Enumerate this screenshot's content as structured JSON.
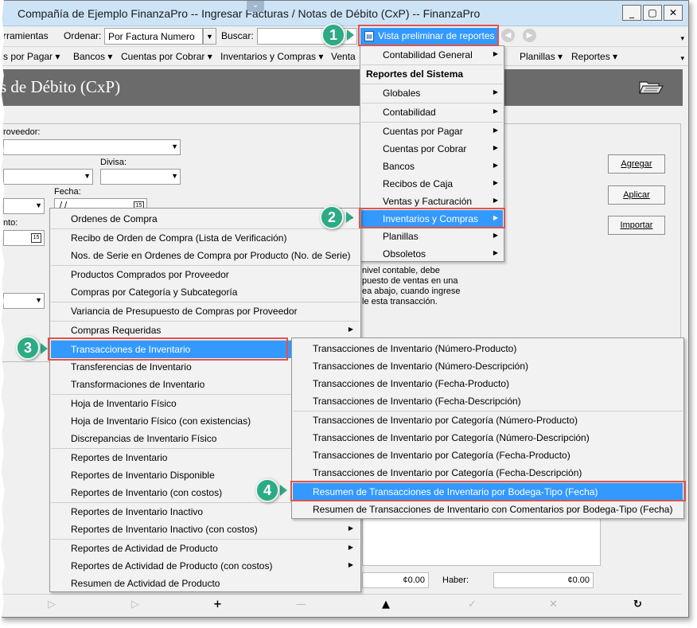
{
  "window": {
    "title": "Compañía de Ejemplo FinanzaPro -- Ingresar Facturas / Notas de Débito (CxP) -- FinanzaPro",
    "handle_glyph": "⌄",
    "controls": {
      "minimize": "_",
      "maximize": "▢",
      "close": "✕"
    }
  },
  "toolbar": {
    "tools_label": "rramientas",
    "order_label": "Ordenar:",
    "order_value": "Por Factura Numero",
    "search_label": "Buscar:",
    "preview_label": "Vista preliminar de reportes",
    "preview_icon_glyph": "▤",
    "back_glyph": "◀",
    "forward_glyph": "▶",
    "overflow_glyph": "▾"
  },
  "menubar": {
    "items": [
      "s por Pagar ▾",
      "Bancos ▾",
      "Cuentas por Cobrar ▾",
      "Inventarios y Compras ▾",
      "Venta",
      "Planillas ▾",
      "Reportes ▾"
    ]
  },
  "form": {
    "title": "s de Débito (CxP)",
    "fields": {
      "proveedor_label": "roveedor:",
      "divisa_label": "Divisa:",
      "fecha_label": "Fecha:",
      "fecha_value": "/ /",
      "vencimiento_label": "nto:",
      "calendar_glyph": "15"
    },
    "buttons": {
      "agregar": "Agregar",
      "aplicar": "Aplicar",
      "importar": "Importar"
    },
    "note_lines": [
      "nivel contable, debe",
      "puesto de ventas en una",
      "ea abajo, cuando ingrese",
      "le esta transacción."
    ],
    "totals": {
      "debe_value": "¢0.00",
      "haber_label": "Haber:",
      "haber_value": "¢0.00"
    },
    "bottom_icons": [
      "▷",
      "▷",
      "+",
      "—",
      "▲",
      "✓",
      "✕",
      "↻"
    ]
  },
  "reports_menu": {
    "items": [
      {
        "label": "Contabilidad General",
        "submenu": true
      },
      {
        "label": "Reportes del Sistema",
        "header": true
      },
      {
        "label": "Globales",
        "submenu": true
      },
      {
        "label": "Contabilidad",
        "submenu": true
      },
      {
        "label": "Cuentas por Pagar",
        "submenu": true
      },
      {
        "label": "Cuentas por Cobrar",
        "submenu": true
      },
      {
        "label": "Bancos",
        "submenu": true
      },
      {
        "label": "Recibos de Caja",
        "submenu": true
      },
      {
        "label": "Ventas y Facturación",
        "submenu": true
      },
      {
        "label": "Inventarios y Compras",
        "submenu": true,
        "selected": true
      },
      {
        "label": "Planillas",
        "submenu": true
      },
      {
        "label": "Obsoletos",
        "submenu": true
      }
    ]
  },
  "inventory_menu": {
    "items": [
      {
        "label": "Ordenes de Compra",
        "submenu": true
      },
      {
        "label": "Recibo de Orden de Compra (Lista de Verificación)"
      },
      {
        "label": "Nos. de Serie en Ordenes de Compra por Producto (No. de Serie)"
      },
      {
        "label": "Productos Comprados por Proveedor"
      },
      {
        "label": "Compras por Categoría y Subcategoría"
      },
      {
        "label": "Variancia de Presupuesto de Compras por Proveedor"
      },
      {
        "label": "Compras Requeridas",
        "submenu": true
      },
      {
        "label": "Transacciones de Inventario",
        "submenu": true,
        "selected": true
      },
      {
        "label": "Transferencias de Inventario"
      },
      {
        "label": "Transformaciones de Inventario"
      },
      {
        "label": "Hoja de Inventario Físico"
      },
      {
        "label": "Hoja de Inventario Físico (con existencias)"
      },
      {
        "label": "Discrepancias de Inventario Físico"
      },
      {
        "label": "Reportes de Inventario"
      },
      {
        "label": "Reportes de Inventario Disponible"
      },
      {
        "label": "Reportes de Inventario (con costos)"
      },
      {
        "label": "Reportes de Inventario Inactivo"
      },
      {
        "label": "Reportes de Inventario Inactivo (con costos)",
        "submenu": true
      },
      {
        "label": "Reportes de Actividad de Producto",
        "submenu": true
      },
      {
        "label": "Reportes de Actividad de Producto (con costos)",
        "submenu": true
      },
      {
        "label": "Resumen de Actividad de Producto"
      }
    ]
  },
  "transactions_menu": {
    "items": [
      {
        "label": "Transacciones de Inventario (Número-Producto)"
      },
      {
        "label": "Transacciones de Inventario (Número-Descripción)"
      },
      {
        "label": "Transacciones de Inventario (Fecha-Producto)"
      },
      {
        "label": "Transacciones de Inventario (Fecha-Descripción)"
      },
      {
        "label": "Transacciones de Inventario por Categoría (Número-Producto)"
      },
      {
        "label": "Transacciones de Inventario por Categoría (Número-Descripción)"
      },
      {
        "label": "Transacciones de Inventario por Categoría (Fecha-Producto)"
      },
      {
        "label": "Transacciones de Inventario por Categoría (Fecha-Descripción)"
      },
      {
        "label": "Resumen de Transacciones de Inventario por Bodega-Tipo (Fecha)",
        "selected": true
      },
      {
        "label": "Resumen de Transacciones de Inventario con Comentarios por Bodega-Tipo (Fecha)"
      }
    ]
  },
  "callouts": [
    "1",
    "2",
    "3",
    "4"
  ],
  "glyphs": {
    "submenu_arrow": "▶",
    "combo_arrow": "▼"
  },
  "colors": {
    "highlight": "#3399ff",
    "callout": "#2daa86",
    "callout_border": "#e0544b"
  }
}
